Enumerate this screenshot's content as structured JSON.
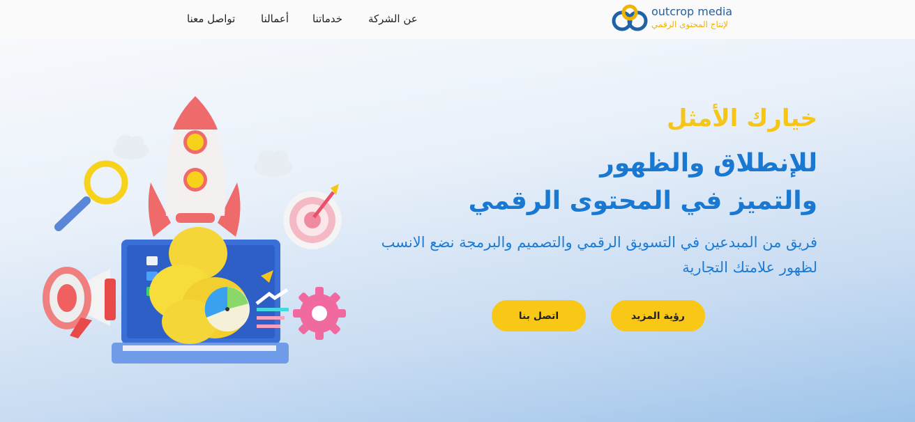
{
  "header": {
    "logo": {
      "name": "outcrop media",
      "tagline": "لإنتاج المحتوى الرقمي"
    },
    "nav": [
      "عن الشركة",
      "خدماتنا",
      "أعمالنا",
      "تواصل معنا"
    ]
  },
  "hero": {
    "eyebrow": "خيارك الأمثل",
    "title_line1": "للإنطلاق والظهور",
    "title_line2": "والتميز في المحتوى الرقمي",
    "description": "فريق من المبدعين في التسويق الرقمي والتصميم والبرمجة نضع الانسب لظهور علامتك التجارية",
    "buttons": {
      "primary": "رؤية المزيد",
      "secondary": "اتصل بنا"
    }
  },
  "colors": {
    "accent_yellow": "#f9c816",
    "brand_blue": "#1878d2",
    "heading_yellow": "#f5c518"
  },
  "illustration": {
    "icons": [
      "rocket-icon",
      "laptop-icon",
      "megaphone-icon",
      "magnifier-icon",
      "target-icon",
      "gear-icon",
      "cloud-icon",
      "pie-chart-icon"
    ]
  }
}
